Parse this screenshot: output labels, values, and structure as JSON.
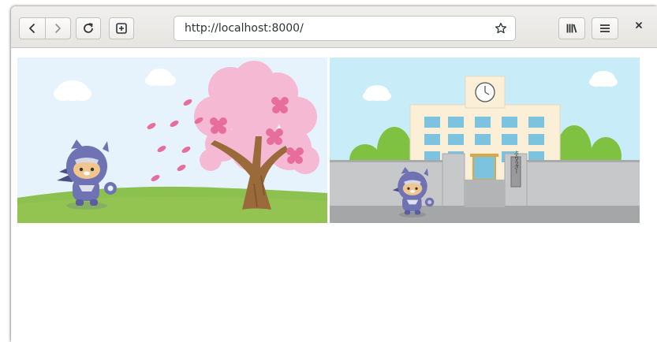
{
  "browser": {
    "url": "http://localhost:8000/",
    "buttons": {
      "back": "back-icon",
      "forward": "forward-icon",
      "reload": "reload-icon",
      "new_tab": "new-tab-icon",
      "bookmark": "star-icon",
      "library": "library-icon",
      "menu": "hamburger-menu-icon",
      "close": "close-icon"
    }
  },
  "page": {
    "images": [
      {
        "name": "ninja-cherry-blossom-illustration"
      },
      {
        "name": "ninja-school-gate-illustration",
        "gate_sign": "ぶらうざー"
      }
    ]
  }
}
